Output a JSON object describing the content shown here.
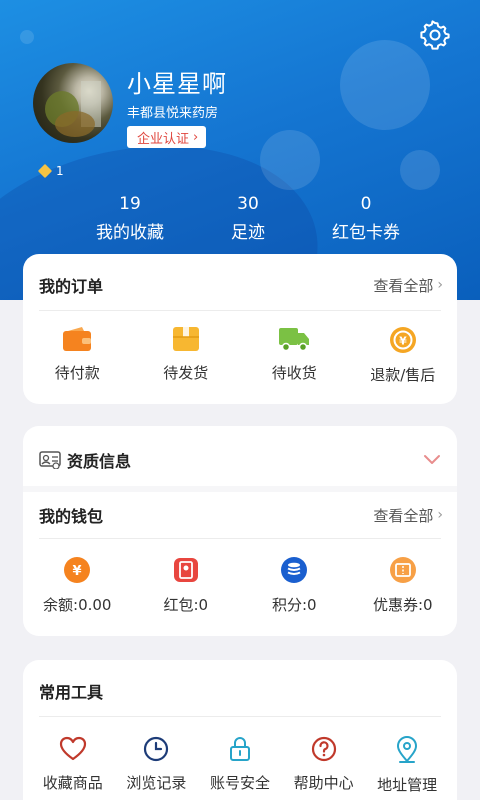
{
  "profile": {
    "username": "小星星啊",
    "store": "丰都县悦来药房",
    "cert_label": "企业认证",
    "level": "1"
  },
  "stats": [
    {
      "num": "19",
      "label": "我的收藏"
    },
    {
      "num": "30",
      "label": "足迹"
    },
    {
      "num": "0",
      "label": "红包卡券"
    }
  ],
  "orders": {
    "title": "我的订单",
    "see_all": "查看全部",
    "items": [
      {
        "label": "待付款",
        "icon": "wallet-icon"
      },
      {
        "label": "待发货",
        "icon": "package-icon"
      },
      {
        "label": "待收货",
        "icon": "truck-icon"
      },
      {
        "label": "退款/售后",
        "icon": "refund-icon"
      }
    ]
  },
  "qualification": {
    "title": "资质信息"
  },
  "wallet": {
    "title": "我的钱包",
    "see_all": "查看全部",
    "items": [
      {
        "label": "余额:0.00",
        "icon": "balance-icon"
      },
      {
        "label": "红包:0",
        "icon": "red-packet-icon"
      },
      {
        "label": "积分:0",
        "icon": "points-icon"
      },
      {
        "label": "优惠券:0",
        "icon": "coupon-icon"
      }
    ]
  },
  "tools": {
    "title": "常用工具",
    "items": [
      {
        "label": "收藏商品",
        "icon": "heart-icon"
      },
      {
        "label": "浏览记录",
        "icon": "clock-icon"
      },
      {
        "label": "账号安全",
        "icon": "lock-icon"
      },
      {
        "label": "帮助中心",
        "icon": "question-icon"
      },
      {
        "label": "地址管理",
        "icon": "location-icon"
      }
    ]
  },
  "colors": {
    "header_blue": "#1576d2",
    "accent_orange": "#f5831f",
    "accent_red": "#e0463e",
    "truck_green": "#7bc144",
    "points_blue": "#1a5fcf"
  }
}
